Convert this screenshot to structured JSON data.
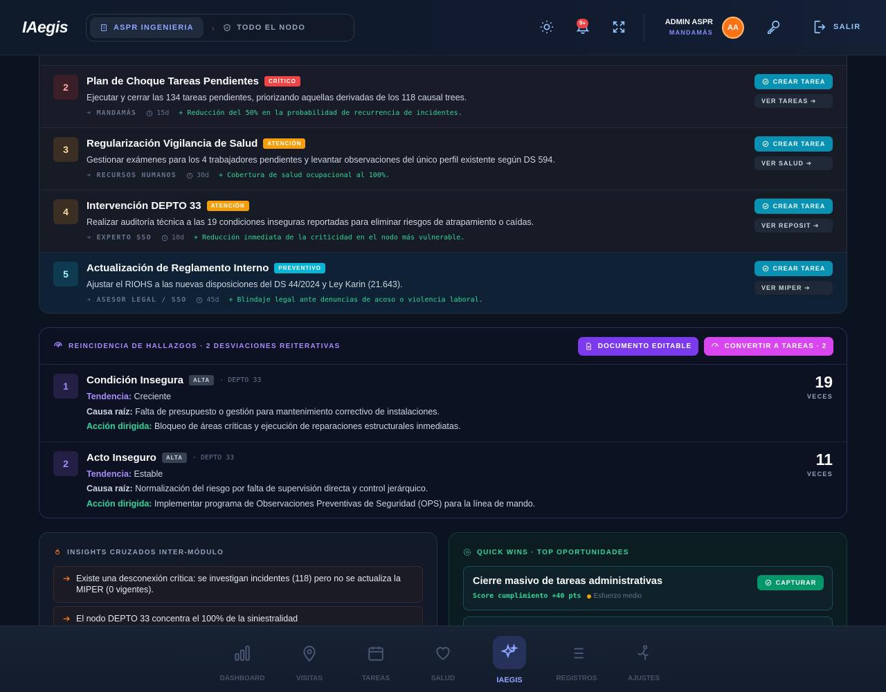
{
  "topbar": {
    "logo": "IAegis",
    "breadcrumb_active": "ASPR INGENIERIA",
    "breadcrumb_node": "TODO EL NODO",
    "notification_badge": "9+",
    "user_name": "ADMIN ASPR",
    "user_role": "MANDAMÁS",
    "avatar_initials": "AA",
    "logout_label": "SALIR"
  },
  "plan": {
    "items": [
      {
        "num": "2",
        "title": "Plan de Choque Tareas Pendientes",
        "tag": "CRÍTICO",
        "desc": "Ejecutar y cerrar las 134 tareas pendientes, priorizando aquellas derivadas de los 118 causal trees.",
        "owner": "➔ MANDAMÁS",
        "time": "15d",
        "impact": "+ Reducción del 50% en la probabilidad de recurrencia de incidentes.",
        "create_label": "CREAR TAREA",
        "view_label": "VER TAREAS ➔"
      },
      {
        "num": "3",
        "title": "Regularización Vigilancia de Salud",
        "tag": "ATENCIÓN",
        "desc": "Gestionar exámenes para los 4 trabajadores pendientes y levantar observaciones del único perfil existente según DS 594.",
        "owner": "➔ RECURSOS HUMANOS",
        "time": "30d",
        "impact": "+ Cobertura de salud ocupacional al 100%.",
        "create_label": "CREAR TAREA",
        "view_label": "VER SALUD ➔"
      },
      {
        "num": "4",
        "title": "Intervención DEPTO 33",
        "tag": "ATENCIÓN",
        "desc": "Realizar auditoría técnica a las 19 condiciones inseguras reportadas para eliminar riesgos de atrapamiento o caídas.",
        "owner": "➔ EXPERTO SSO",
        "time": "10d",
        "impact": "+ Reducción inmediata de la criticidad en el nodo más vulnerable.",
        "create_label": "CREAR TAREA",
        "view_label": "VER REPOSIT ➔"
      },
      {
        "num": "5",
        "title": "Actualización de Reglamento Interno",
        "tag": "PREVENTIVO",
        "desc": "Ajustar el RIOHS a las nuevas disposiciones del DS 44/2024 y Ley Karin (21.643).",
        "owner": "➔ ASESOR LEGAL / SSO",
        "time": "45d",
        "impact": "+ Blindaje legal ante denuncias de acoso o violencia laboral.",
        "create_label": "CREAR TAREA",
        "view_label": "VER MIPER ➔"
      }
    ]
  },
  "recurrence": {
    "title": "REINCIDENCIA DE HALLAZGOS · 2 DESVIACIONES REITERATIVAS",
    "doc_button": "DOCUMENTO EDITABLE",
    "convert_button": "CONVERTIR A TAREAS · 2",
    "labels": {
      "trend": "Tendencia:",
      "cause": "Causa raíz:",
      "action": "Acción dirigida:"
    },
    "items": [
      {
        "num": "1",
        "title": "Condición Insegura",
        "tag": "ALTA",
        "location": "· DEPTO 33",
        "trend": "Creciente",
        "cause": "Falta de presupuesto o gestión para mantenimiento correctivo de instalaciones.",
        "action": "Bloqueo de áreas críticas y ejecución de reparaciones estructurales inmediatas.",
        "count": "19",
        "count_unit": "VECES"
      },
      {
        "num": "2",
        "title": "Acto Inseguro",
        "tag": "ALTA",
        "location": "· DEPTO 33",
        "trend": "Estable",
        "cause": "Normalización del riesgo por falta de supervisión directa y control jerárquico.",
        "action": "Implementar programa de Observaciones Preventivas de Seguridad (OPS) para la línea de mando.",
        "count": "11",
        "count_unit": "VECES"
      }
    ]
  },
  "insights": {
    "title": "INSIGHTS CRUZADOS INTER-MÓDULO",
    "items": [
      "Existe una desconexión crítica: se investigan incidentes (118) pero no se actualiza la MIPER (0 vigentes).",
      "El nodo DEPTO 33 concentra el 100% de la siniestralidad"
    ]
  },
  "quickwins": {
    "title": "QUICK WINS · TOP OPORTUNIDADES",
    "items": [
      {
        "title": "Cierre masivo de tareas administrativas",
        "score": "Score cumplimiento +40 pts",
        "effort": "Esfuerzo medio",
        "button": "CAPTURAR"
      }
    ]
  },
  "bottomnav": {
    "items": [
      {
        "label": "DASHBOARD",
        "icon": "bar-chart-icon"
      },
      {
        "label": "VISITAS",
        "icon": "map-pin-icon"
      },
      {
        "label": "TAREAS",
        "icon": "calendar-icon"
      },
      {
        "label": "SALUD",
        "icon": "heart-icon"
      },
      {
        "label": "IAEGIS",
        "icon": "sparkles-icon",
        "active": true
      },
      {
        "label": "REGISTROS",
        "icon": "list-icon"
      },
      {
        "label": "AJUSTES",
        "icon": "settings-icon"
      }
    ]
  },
  "colors": {
    "background": "#0b1220",
    "accent": "#8fa7ff",
    "critical": "#ef4444",
    "warning": "#f59e0b",
    "preventive": "#06b6d4",
    "success": "#34d399",
    "violet": "#7c3aed",
    "magenta": "#d946ef"
  }
}
